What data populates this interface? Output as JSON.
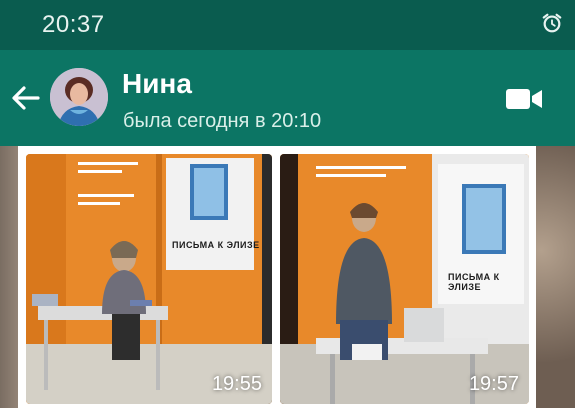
{
  "status_bar": {
    "time": "20:37",
    "alarm_icon": "alarm-clock-icon"
  },
  "header": {
    "back_icon": "arrow-left-icon",
    "contact_name": "Нина",
    "last_seen": "была сегодня в 20:10",
    "video_icon": "video-camera-icon"
  },
  "messages": [
    {
      "type": "image",
      "time": "19:55",
      "poster_title": "ПИСЬМА К ЭЛИЗЕ"
    },
    {
      "type": "image",
      "time": "19:57",
      "poster_title": "ПИСЬМА К ЭЛИЗЕ"
    }
  ],
  "colors": {
    "status_bar": "#0a5c4f",
    "header": "#0c7564",
    "booth_orange": "#e88a24"
  }
}
